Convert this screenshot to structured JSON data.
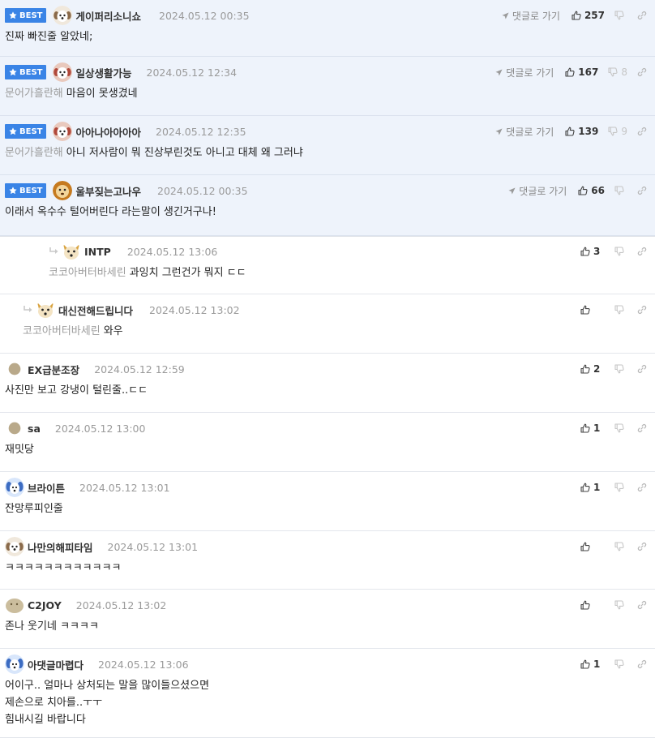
{
  "labels": {
    "best": "BEST",
    "goto": "댓글로 가기"
  },
  "colors": {
    "best_badge": "#3a84e6",
    "best_bg": "#eef3fb"
  },
  "comments": [
    {
      "best": true,
      "avatar": "puppy-white",
      "nick": "게이퍼리소니쇼",
      "date": "2024.05.12 00:35",
      "likes": "257",
      "dislikes": "",
      "tag": "",
      "text": [
        "진짜 빠진줄 알았네;"
      ]
    },
    {
      "best": true,
      "avatar": "puppy-red",
      "nick": "일상생활가능",
      "date": "2024.05.12 12:34",
      "likes": "167",
      "dislikes": "8",
      "tag": "문어가흘란해",
      "text": [
        "마음이 못생겼네"
      ]
    },
    {
      "best": true,
      "avatar": "puppy-red",
      "nick": "아아나아아아아",
      "date": "2024.05.12 12:35",
      "likes": "139",
      "dislikes": "9",
      "tag": "문어가흘란해",
      "text": [
        "아니 저사람이 뭐 진상부린것도 아니고 대체 왜 그러냐"
      ]
    },
    {
      "best": true,
      "avatar": "lion",
      "nick": "울부짖는고나우",
      "date": "2024.05.12 00:35",
      "likes": "66",
      "dislikes": "",
      "tag": "",
      "text": [
        "이래서 옥수수 털어버린다 라는말이 생긴거구나!"
      ]
    },
    {
      "best": false,
      "reply": 2,
      "avatar": "fox",
      "nick": "INTP",
      "date": "2024.05.12 13:06",
      "likes": "3",
      "dislikes": "",
      "tag": "코코아버터바세린",
      "text": [
        "과잉치 그런건가 뭐지 ㄷㄷ"
      ]
    },
    {
      "best": false,
      "reply": 1,
      "avatar": "fox",
      "nick": "대신전해드립니다",
      "date": "2024.05.12 13:02",
      "likes": "",
      "dislikes": "",
      "tag": "코코아버터바세린",
      "text": [
        "와우"
      ]
    },
    {
      "best": false,
      "avatar": "dot",
      "nick": "EX급분조장",
      "date": "2024.05.12 12:59",
      "likes": "2",
      "dislikes": "",
      "tag": "",
      "text": [
        "사진만 보고 강냉이 털린줄..ㄷㄷ"
      ]
    },
    {
      "best": false,
      "avatar": "dot",
      "nick": "sa",
      "date": "2024.05.12 13:00",
      "likes": "1",
      "dislikes": "",
      "tag": "",
      "text": [
        "재밋당"
      ]
    },
    {
      "best": false,
      "avatar": "blue-dog",
      "nick": "브라이튼",
      "date": "2024.05.12 13:01",
      "likes": "1",
      "dislikes": "",
      "tag": "",
      "text": [
        "잔망루피인줄"
      ]
    },
    {
      "best": false,
      "avatar": "puppy-white",
      "nick": "나만의해피타임",
      "date": "2024.05.12 13:01",
      "likes": "",
      "dislikes": "",
      "tag": "",
      "text": [
        "ㅋㅋㅋㅋㅋㅋㅋㅋㅋㅋㅋㅋ"
      ]
    },
    {
      "best": false,
      "avatar": "potato",
      "nick": "C2JOY",
      "date": "2024.05.12 13:02",
      "likes": "",
      "dislikes": "",
      "tag": "",
      "text": [
        "존나 웃기네 ㅋㅋㅋㅋ"
      ]
    },
    {
      "best": false,
      "avatar": "blue-dog",
      "nick": "아댓글마렵다",
      "date": "2024.05.12 13:06",
      "likes": "1",
      "dislikes": "",
      "tag": "",
      "text": [
        "어이구.. 얼마나 상처되는 말을 많이들으셨으면",
        "제손으로 치아를..ㅜㅜ",
        "힘내시길 바랍니다"
      ]
    }
  ]
}
